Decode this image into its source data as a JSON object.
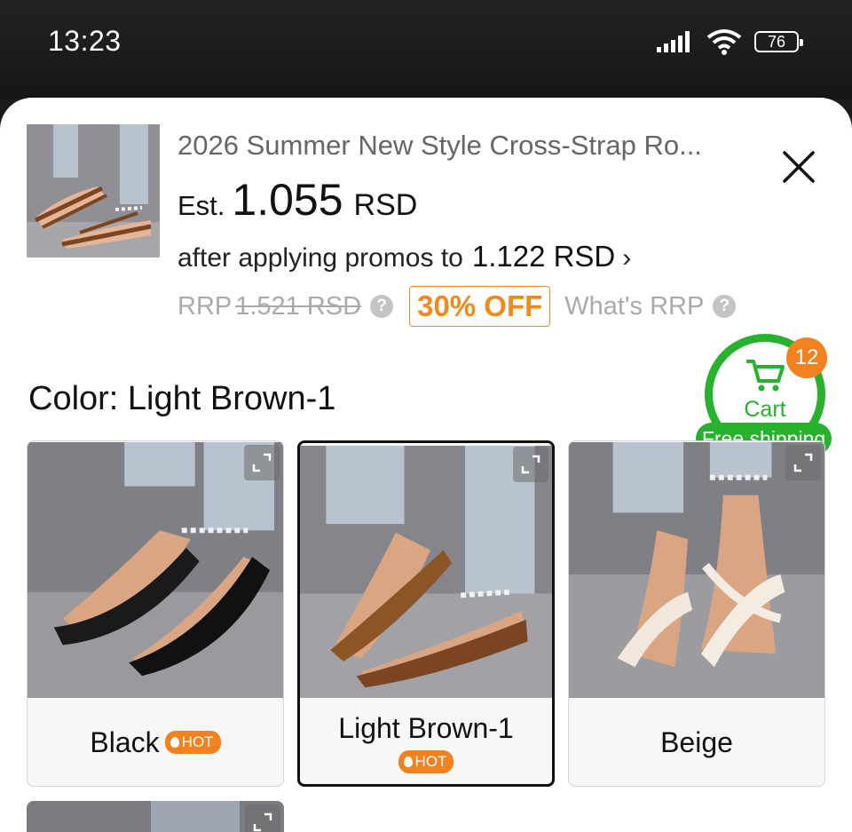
{
  "status": {
    "time": "13:23",
    "battery": "76"
  },
  "product": {
    "title": "2026 Summer New Style Cross-Strap Ro...",
    "est_prefix": "Est.",
    "price": "1.055",
    "currency": "RSD",
    "promo_text": "after applying promos to",
    "promo_price": "1.122 RSD",
    "promo_chevron": "›",
    "rrp_label": "RRP",
    "rrp_price": "1.521 RSD",
    "discount": "30% OFF",
    "whats_rrp": "What's RRP"
  },
  "color": {
    "label": "Color: Light Brown-1"
  },
  "cart": {
    "label": "Cart",
    "count": "12",
    "free_shipping": "Free shipping"
  },
  "variants": [
    {
      "name": "Black",
      "hot": "HOT",
      "selected": false
    },
    {
      "name": "Light Brown-1",
      "hot": "HOT",
      "selected": true
    },
    {
      "name": "Beige",
      "hot": "",
      "selected": false
    }
  ],
  "icons": [
    "signal-icon",
    "wifi-icon",
    "battery-icon",
    "close-icon",
    "help-icon",
    "cart-icon",
    "expand-icon",
    "flame-icon"
  ],
  "colors": {
    "accent_orange": "#f4811f",
    "green": "#27b12c"
  }
}
